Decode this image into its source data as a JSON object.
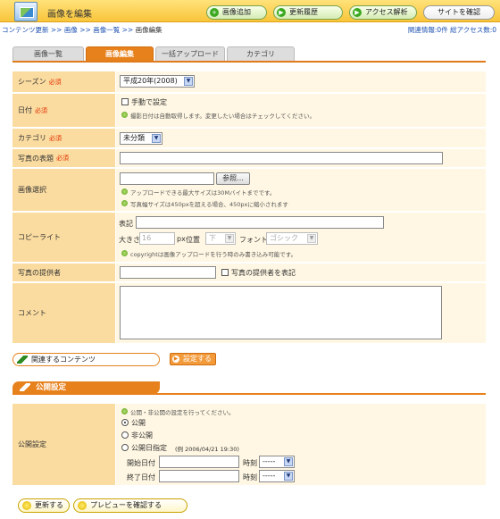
{
  "header": {
    "title": "画像を編集",
    "buttons": [
      {
        "label": "画像追加",
        "icon": "plus-icon"
      },
      {
        "label": "更新履歴",
        "icon": "arrow-icon"
      },
      {
        "label": "アクセス解析",
        "icon": "arrow-icon"
      },
      {
        "label": "サイトを確認"
      }
    ]
  },
  "breadcrumb": {
    "items": [
      "コンテンツ更新",
      "画像",
      "画像一覧"
    ],
    "separator": ">>",
    "current": "画像編集"
  },
  "related": "関連情報:0件 総アクセス数:0",
  "tabs": [
    "画像一覧",
    "画像編集",
    "一括アップロード",
    "カテゴリ"
  ],
  "form": {
    "required_mark": "必須",
    "season": {
      "label": "シーズン",
      "value": "平成20年(2008)"
    },
    "date": {
      "label": "日付",
      "checkbox_label": "手動で設定",
      "hint": "撮影日付は自動取得します。変更したい場合はチェックしてください。"
    },
    "category": {
      "label": "カテゴリ",
      "value": "未分類"
    },
    "photo_title": {
      "label": "写真の表題",
      "value": ""
    },
    "image": {
      "label": "画像選択",
      "browse": "参照...",
      "hints": [
        "アップロードできる最大サイズは30Mバイトまでです。",
        "写真幅サイズは450pxを超える場合、450pxに縮小されます"
      ]
    },
    "copyright": {
      "label": "コピーライト",
      "display_label": "表記",
      "size_label": "大きさ",
      "size_value": "16",
      "size_unit": "px",
      "position_label": "位置",
      "position_value": "下",
      "font_label": "フォント",
      "font_value": "ゴシック",
      "hint": "copyrightは画像アップロードを行う時のみ書き込み可能です。"
    },
    "provider": {
      "label": "写真の提供者",
      "checkbox_label": "写真の提供者を表記"
    },
    "comment": {
      "label": "コメント"
    }
  },
  "related_button": "関連するコンテンツ",
  "set_button": "設定する",
  "publish": {
    "section_title": "公開設定",
    "label": "公開設定",
    "hint": "公開・非公開の設定を行ってください。",
    "options": [
      "公開",
      "非公開",
      "公開日指定"
    ],
    "selected": 0,
    "date_example": "(例 2006/04/21 19:30)",
    "start_label": "開始日付",
    "end_label": "終了日付",
    "time_label": "時刻",
    "time_placeholder": "-----"
  },
  "footer": {
    "update": "更新する",
    "preview": "プレビューを確認する"
  },
  "colors": {
    "accent": "#e7811c",
    "label_bg": "#fbdca0",
    "value_bg": "#fff7e3",
    "header_bg": "#f8c53a"
  }
}
